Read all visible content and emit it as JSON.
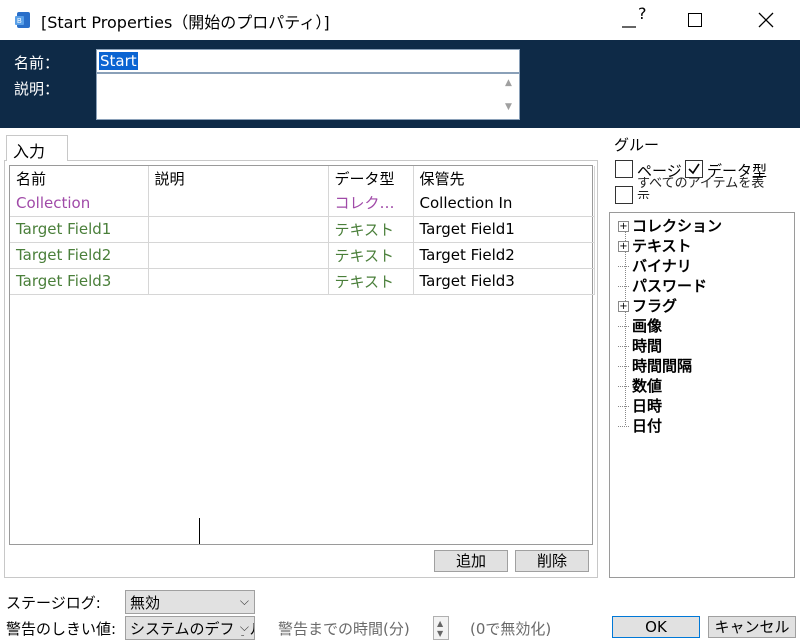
{
  "window": {
    "title": "[Start Properties（開始のプロパティ）]",
    "help": "?",
    "maximize": "☐",
    "close": "✕"
  },
  "header": {
    "name_label": "名前：",
    "desc_label": "説明：",
    "name_value": "Start",
    "desc_value": ""
  },
  "tabs": [
    "入力"
  ],
  "table": {
    "columns": [
      "名前",
      "説明",
      "データ型",
      "保管先"
    ],
    "group": {
      "name": "Collection",
      "description": "",
      "type": "コレクシ…",
      "store": "Collection In"
    },
    "rows": [
      {
        "name": "Target Field1",
        "description": "",
        "type": "テキスト",
        "store": "Target Field1"
      },
      {
        "name": "Target Field2",
        "description": "",
        "type": "テキスト",
        "store": "Target Field2"
      },
      {
        "name": "Target Field3",
        "description": "",
        "type": "テキスト",
        "store": "Target Field3"
      }
    ]
  },
  "buttons": {
    "add": "追加",
    "delete": "削除",
    "ok": "OK",
    "cancel": "キャンセル"
  },
  "group_panel": {
    "title": "グルー",
    "page_label": "ページ",
    "page_checked": false,
    "type_label": "データ型",
    "type_checked": true,
    "all_label": "すべてのアイテムを表示",
    "all_checked": false
  },
  "tree": [
    {
      "label": "コレクション",
      "expandable": true
    },
    {
      "label": "テキスト",
      "expandable": true
    },
    {
      "label": "バイナリ",
      "expandable": false
    },
    {
      "label": "パスワード",
      "expandable": false
    },
    {
      "label": "フラグ",
      "expandable": true
    },
    {
      "label": "画像",
      "expandable": false
    },
    {
      "label": "時間",
      "expandable": false
    },
    {
      "label": "時間間隔",
      "expandable": false
    },
    {
      "label": "数値",
      "expandable": false
    },
    {
      "label": "日時",
      "expandable": false
    },
    {
      "label": "日付",
      "expandable": false
    }
  ],
  "bottom": {
    "stage_log_label": "ステージログ:",
    "stage_log_value": "無効",
    "warn_label": "警告のしきい値:",
    "warn_value": "システムのデフォルト",
    "warn_time_label": "警告までの時間(分)",
    "zero_label": "(0で無効化)"
  },
  "colors": {
    "header_bg": "#0e2a47",
    "field_green": "#4a7f3a",
    "collection_purple": "#a04aa8",
    "selection_blue": "#0a64d2"
  }
}
